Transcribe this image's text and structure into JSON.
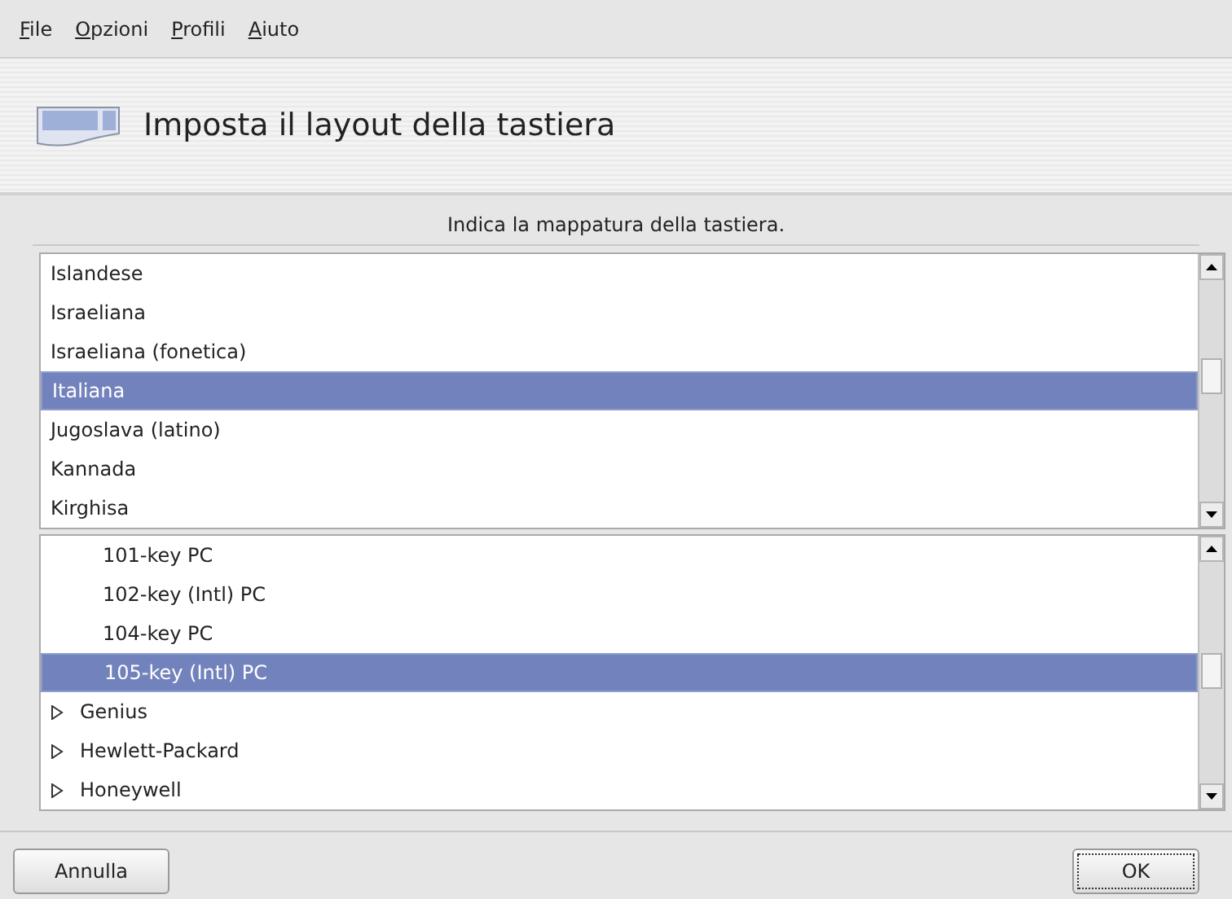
{
  "menu": [
    "File",
    "Opzioni",
    "Profili",
    "Aiuto"
  ],
  "header": {
    "title": "Imposta il layout della tastiera"
  },
  "prompt": "Indica la mappatura della tastiera.",
  "layouts": [
    {
      "label": "Islandese",
      "selected": false
    },
    {
      "label": "Israeliana",
      "selected": false
    },
    {
      "label": "Israeliana (fonetica)",
      "selected": false
    },
    {
      "label": "Italiana",
      "selected": true
    },
    {
      "label": "Jugoslava (latino)",
      "selected": false
    },
    {
      "label": "Kannada",
      "selected": false
    },
    {
      "label": "Kirghisa",
      "selected": false
    }
  ],
  "models": [
    {
      "kind": "child",
      "label": "101-key PC",
      "selected": false
    },
    {
      "kind": "child",
      "label": "102-key (Intl) PC",
      "selected": false
    },
    {
      "kind": "child",
      "label": "104-key PC",
      "selected": false
    },
    {
      "kind": "child",
      "label": "105-key (Intl) PC",
      "selected": true
    },
    {
      "kind": "group",
      "label": "Genius",
      "selected": false,
      "expanded": false
    },
    {
      "kind": "group",
      "label": "Hewlett-Packard",
      "selected": false,
      "expanded": false
    },
    {
      "kind": "group",
      "label": "Honeywell",
      "selected": false,
      "expanded": false
    }
  ],
  "buttons": {
    "cancel": "Annulla",
    "ok": "OK"
  }
}
